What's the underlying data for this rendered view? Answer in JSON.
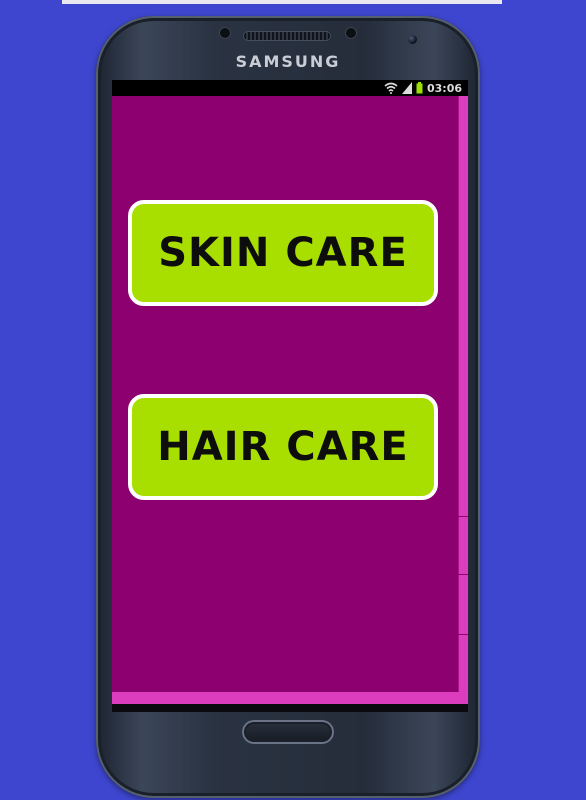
{
  "device": {
    "brand": "SAMSUNG"
  },
  "status_bar": {
    "time": "03:06",
    "icons": [
      "wifi-icon",
      "signal-icon",
      "battery-icon"
    ]
  },
  "buttons": {
    "skin_care": "SKIN CARE",
    "hair_care": "HAIR CARE"
  },
  "colors": {
    "background": "#3e46cf",
    "app_background": "#8c006f",
    "accent_strip": "#dc3cbe",
    "button_fill": "#a8de00",
    "button_border": "#ffffff",
    "button_text": "#0d0d0d"
  }
}
